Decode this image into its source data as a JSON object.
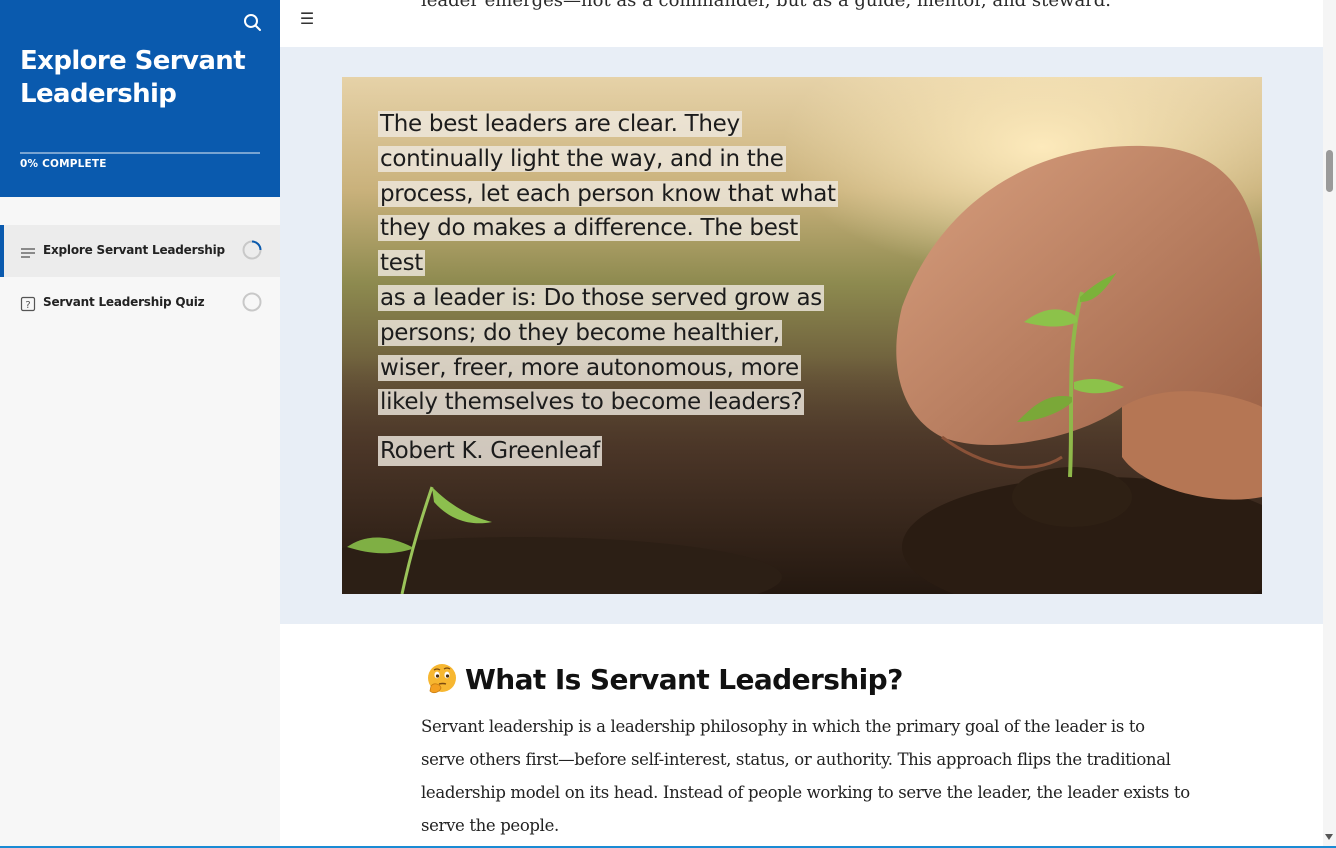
{
  "sidebar": {
    "course_title": "Explore Servant Leadership",
    "progress_label": "0% COMPLETE",
    "progress_percent": 0,
    "search_icon": "search-icon",
    "lessons": [
      {
        "label": "Explore Servant Leadership",
        "icon": "lines-icon",
        "status": "in-progress",
        "active": true
      },
      {
        "label": "Servant Leadership Quiz",
        "icon": "question-box-icon",
        "status": "not-started",
        "active": false
      }
    ]
  },
  "main": {
    "menu_icon": "hamburger-menu-icon",
    "cut_off_text": "leader emerges—not as a commander, but as a guide, mentor, and steward.",
    "quote": {
      "lines": [
        "The best leaders are clear. They",
        "continually light the way, and in the",
        "process, let each person know that what",
        "they do makes a difference. The best test",
        "as a leader is: Do those served grow as",
        "persons; do they become healthier,",
        "wiser, freer, more autonomous, more",
        "likely themselves to become leaders?"
      ],
      "author": "Robert K. Greenleaf"
    },
    "section": {
      "emoji_icon": "thinking-face-icon",
      "heading": "What Is Servant Leadership?",
      "body": "Servant leadership is a leadership philosophy in which the primary goal of the leader is to serve others first—before self-interest, status, or authority. This approach flips the traditional leadership model on its head. Instead of people working to serve the leader, the leader exists to serve the people."
    }
  },
  "colors": {
    "brand_blue": "#0a5aae",
    "section_bg": "#e8eef6",
    "accent_line": "#1a8bd4"
  }
}
